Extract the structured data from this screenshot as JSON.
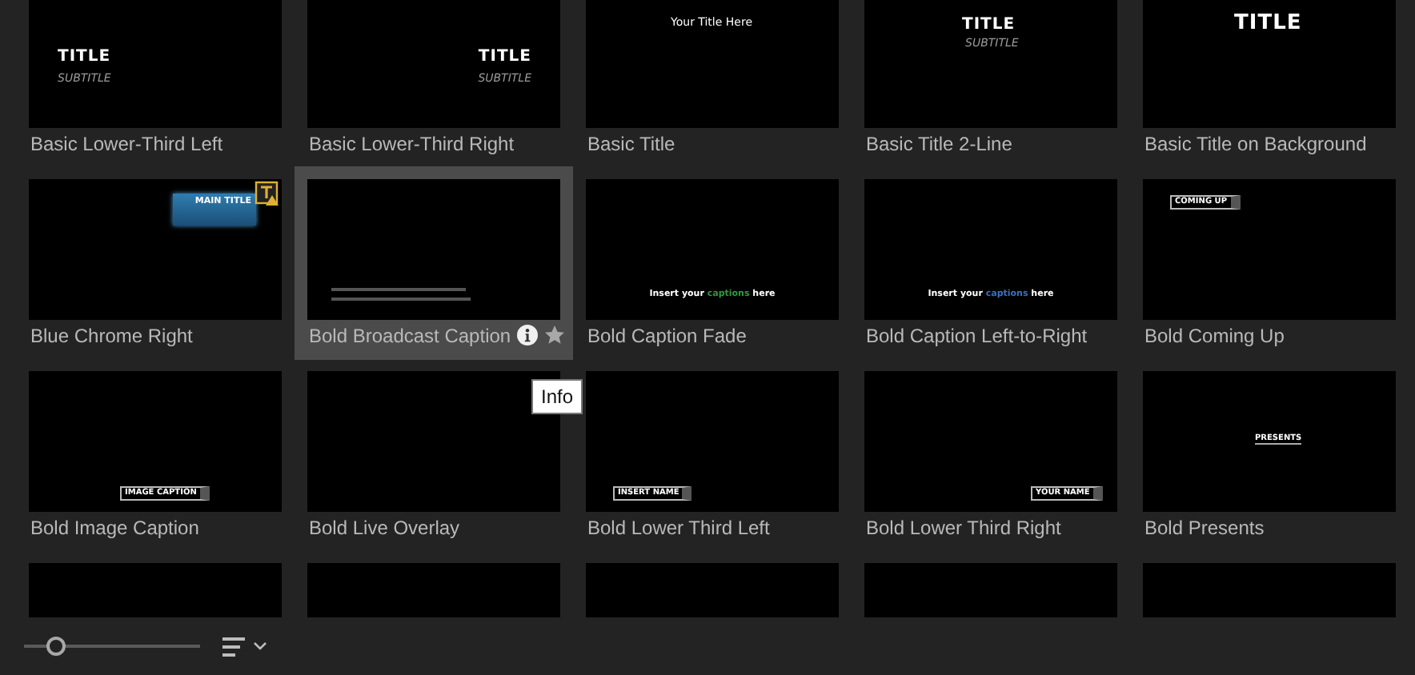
{
  "items": [
    {
      "label": "Basic Lower-Third Left",
      "selected": false,
      "warning": false,
      "preview": {
        "kind": "title-left",
        "texts": [
          "TITLE",
          "SUBTITLE"
        ]
      }
    },
    {
      "label": "Basic Lower-Third Right",
      "selected": false,
      "warning": false,
      "preview": {
        "kind": "title-right",
        "texts": [
          "TITLE",
          "SUBTITLE"
        ]
      }
    },
    {
      "label": "Basic Title",
      "selected": false,
      "warning": false,
      "preview": {
        "kind": "top-line",
        "texts": [
          "Your Title Here"
        ]
      }
    },
    {
      "label": "Basic Title 2-Line",
      "selected": false,
      "warning": false,
      "preview": {
        "kind": "title-center",
        "texts": [
          "TITLE",
          "SUBTITLE"
        ]
      }
    },
    {
      "label": "Basic Title on Background",
      "selected": false,
      "warning": false,
      "preview": {
        "kind": "title-big",
        "texts": [
          "TITLE"
        ]
      }
    },
    {
      "label": "Blue Chrome Right",
      "selected": false,
      "warning": true,
      "preview": {
        "kind": "chrome",
        "texts": [
          "MAIN TITLE"
        ]
      }
    },
    {
      "label": "Bold Broadcast Caption",
      "selected": true,
      "warning": false,
      "preview": {
        "kind": "broadcast"
      }
    },
    {
      "label": "Bold Caption Fade",
      "selected": false,
      "warning": false,
      "preview": {
        "kind": "caption",
        "texts": [
          "Insert your",
          "captions",
          "here"
        ],
        "color": "#2f9a3a"
      }
    },
    {
      "label": "Bold Caption Left-to-Right",
      "selected": false,
      "warning": false,
      "preview": {
        "kind": "caption",
        "texts": [
          "Insert your",
          "captions",
          "here"
        ],
        "color": "#3b6fc4"
      }
    },
    {
      "label": "Bold Coming Up",
      "selected": false,
      "warning": false,
      "preview": {
        "kind": "tag-top-left",
        "texts": [
          "COMING UP"
        ]
      }
    },
    {
      "label": "Bold Image Caption",
      "selected": false,
      "warning": false,
      "preview": {
        "kind": "tag-bottom-center",
        "texts": [
          "IMAGE CAPTION"
        ]
      }
    },
    {
      "label": "Bold Live Overlay",
      "selected": false,
      "warning": false,
      "preview": {
        "kind": "blank"
      }
    },
    {
      "label": "Bold Lower Third Left",
      "selected": false,
      "warning": false,
      "preview": {
        "kind": "tag-bottom-left",
        "texts": [
          "INSERT NAME"
        ]
      }
    },
    {
      "label": "Bold Lower Third Right",
      "selected": false,
      "warning": false,
      "preview": {
        "kind": "tag-bottom-right",
        "texts": [
          "YOUR NAME"
        ]
      }
    },
    {
      "label": "Bold Presents",
      "selected": false,
      "warning": false,
      "preview": {
        "kind": "tag-center",
        "texts": [
          "PRESENTS"
        ]
      }
    },
    {
      "selected": false,
      "warning": false,
      "preview": {
        "kind": "blank"
      }
    },
    {
      "selected": false,
      "warning": false,
      "preview": {
        "kind": "blank"
      }
    },
    {
      "selected": false,
      "warning": false,
      "preview": {
        "kind": "blank"
      }
    },
    {
      "selected": false,
      "warning": false,
      "preview": {
        "kind": "blank"
      }
    },
    {
      "selected": false,
      "warning": false,
      "preview": {
        "kind": "blank"
      }
    }
  ],
  "tooltip": "Info",
  "zoom_slider": {
    "level": 0.18
  }
}
